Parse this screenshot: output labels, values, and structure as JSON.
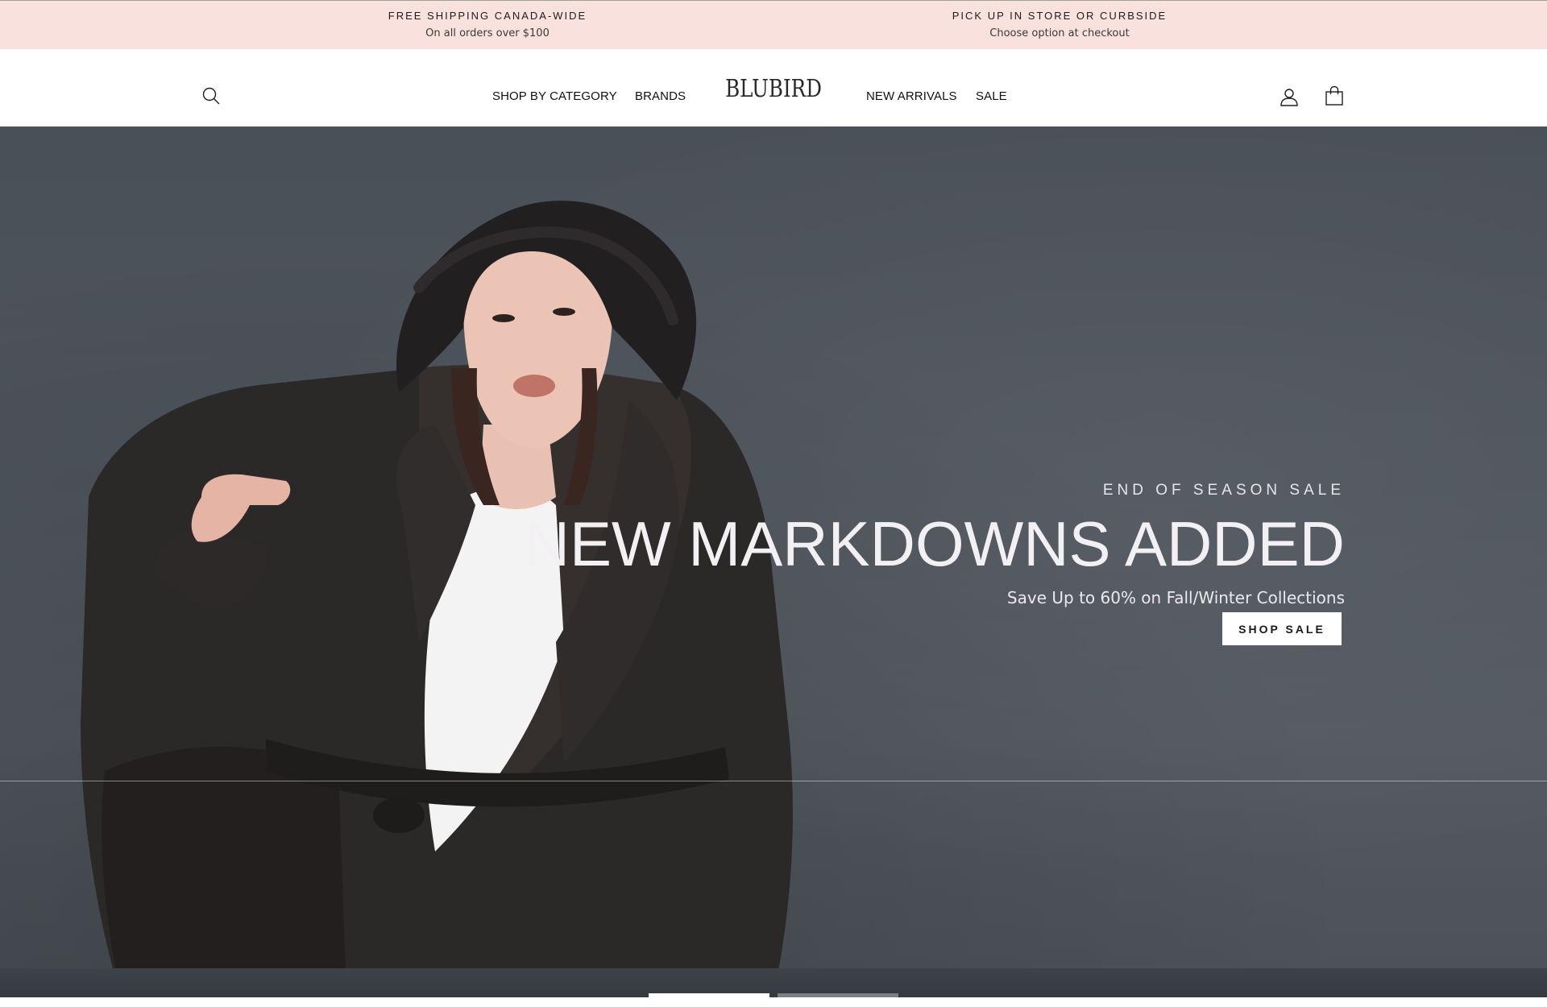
{
  "announcement": {
    "left": {
      "title": "FREE SHIPPING CANADA-WIDE",
      "subtitle": "On all orders over $100"
    },
    "right": {
      "title": "PICK UP IN STORE OR CURBSIDE",
      "subtitle": "Choose option at checkout"
    },
    "background": "#f9e1dd"
  },
  "header": {
    "logo": "BLUBIRD",
    "nav_left": [
      {
        "label": "SHOP BY CATEGORY"
      },
      {
        "label": "BRANDS"
      }
    ],
    "nav_right": [
      {
        "label": "NEW ARRIVALS"
      },
      {
        "label": "SALE"
      }
    ],
    "icons": {
      "search": "search-icon",
      "account": "user-icon",
      "cart": "shopping-bag-icon"
    }
  },
  "hero": {
    "eyebrow": "END OF SEASON SALE",
    "heading": "NEW MARKDOWNS ADDED",
    "subheading": "Save Up to 60% on Fall/Winter Collections",
    "button_label": "SHOP SALE",
    "slides_total": 2,
    "active_slide": 1
  }
}
